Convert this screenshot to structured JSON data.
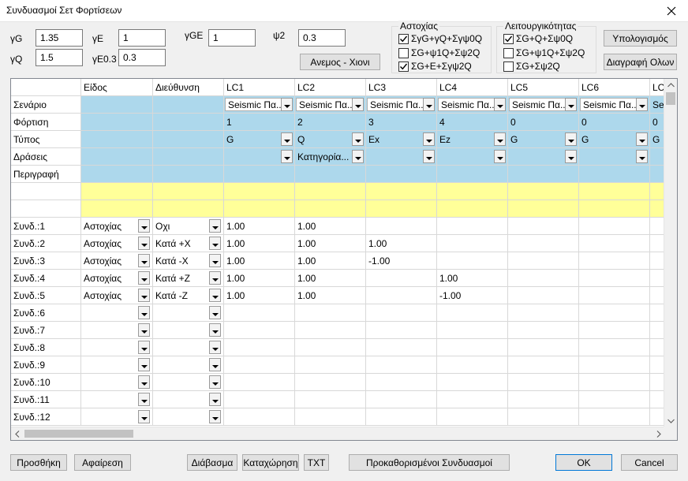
{
  "window": {
    "title": "Συνδυασμοί Σετ Φορτίσεων"
  },
  "params": {
    "gG_label": "γG",
    "gG": "1.35",
    "gQ_label": "γQ",
    "gQ": "1.5",
    "gE_label": "γE",
    "gE": "1",
    "gE03_label": "γE0.3",
    "gE03": "0.3",
    "gGE_label": "γGE",
    "gGE": "1",
    "psi2_label": "ψ2",
    "psi2": "0.3"
  },
  "buttons": {
    "wind_snow": "Ανεμος - Χιονι",
    "calculate": "Υπολογισμός",
    "delete_all": "Διαγραφή Ολων",
    "add": "Προσθήκη",
    "remove": "Αφαίρεση",
    "read": "Διάβασμα",
    "record": "Καταχώρηση",
    "txt": "TXT",
    "predefined": "Προκαθορισμένοι Συνδυασμοί",
    "ok": "OK",
    "cancel": "Cancel"
  },
  "ultimate": {
    "title": "Αστοχίας",
    "options": [
      {
        "label": "ΣγG+γQ+Σγψ0Q",
        "checked": true
      },
      {
        "label": "ΣG+ψ1Q+Σψ2Q",
        "checked": false
      },
      {
        "label": "ΣG+E+Σγψ2Q",
        "checked": true
      }
    ]
  },
  "service": {
    "title": "Λειτουργικότητας",
    "options": [
      {
        "label": "ΣG+Q+Σψ0Q",
        "checked": true
      },
      {
        "label": "ΣG+ψ1Q+Σψ2Q",
        "checked": false
      },
      {
        "label": "ΣG+Σψ2Q",
        "checked": false
      }
    ]
  },
  "grid": {
    "headers": [
      "",
      "Είδος",
      "Διεύθυνση",
      "LC1",
      "LC2",
      "LC3",
      "LC4",
      "LC5",
      "LC6",
      "LC"
    ],
    "prop_rows": [
      {
        "label": "Σενάριο",
        "values": [
          "Seismic Πα...",
          "Seismic Πα...",
          "Seismic Πα...",
          "Seismic Πα...",
          "Seismic Πα...",
          "Seismic Πα...",
          "Sei"
        ]
      },
      {
        "label": "Φόρτιση",
        "values": [
          "1",
          "2",
          "3",
          "4",
          "0",
          "0",
          "0"
        ]
      },
      {
        "label": "Τύπος",
        "values": [
          "G",
          "Q",
          "Ex",
          "Ez",
          "G",
          "G",
          "G"
        ]
      },
      {
        "label": "Δράσεις",
        "values": [
          "",
          "Κατηγορία...",
          "",
          "",
          "",
          "",
          ""
        ]
      },
      {
        "label": "Περιγραφή",
        "values": [
          "",
          "",
          "",
          "",
          "",
          "",
          ""
        ]
      }
    ],
    "combos": [
      {
        "label": "Συνδ.:1",
        "type": "Αστοχίας",
        "dir": "Οχι",
        "lc": [
          "1.00",
          "1.00",
          "",
          "",
          "",
          "",
          ""
        ]
      },
      {
        "label": "Συνδ.:2",
        "type": "Αστοχίας",
        "dir": "Κατά +X",
        "lc": [
          "1.00",
          "1.00",
          "1.00",
          "",
          "",
          "",
          ""
        ]
      },
      {
        "label": "Συνδ.:3",
        "type": "Αστοχίας",
        "dir": "Κατά -X",
        "lc": [
          "1.00",
          "1.00",
          "-1.00",
          "",
          "",
          "",
          ""
        ]
      },
      {
        "label": "Συνδ.:4",
        "type": "Αστοχίας",
        "dir": "Κατά +Z",
        "lc": [
          "1.00",
          "1.00",
          "",
          "1.00",
          "",
          "",
          ""
        ]
      },
      {
        "label": "Συνδ.:5",
        "type": "Αστοχίας",
        "dir": "Κατά -Z",
        "lc": [
          "1.00",
          "1.00",
          "",
          "-1.00",
          "",
          "",
          ""
        ]
      },
      {
        "label": "Συνδ.:6",
        "type": "",
        "dir": "",
        "lc": [
          "",
          "",
          "",
          "",
          "",
          "",
          ""
        ]
      },
      {
        "label": "Συνδ.:7",
        "type": "",
        "dir": "",
        "lc": [
          "",
          "",
          "",
          "",
          "",
          "",
          ""
        ]
      },
      {
        "label": "Συνδ.:8",
        "type": "",
        "dir": "",
        "lc": [
          "",
          "",
          "",
          "",
          "",
          "",
          ""
        ]
      },
      {
        "label": "Συνδ.:9",
        "type": "",
        "dir": "",
        "lc": [
          "",
          "",
          "",
          "",
          "",
          "",
          ""
        ]
      },
      {
        "label": "Συνδ.:10",
        "type": "",
        "dir": "",
        "lc": [
          "",
          "",
          "",
          "",
          "",
          "",
          ""
        ]
      },
      {
        "label": "Συνδ.:11",
        "type": "",
        "dir": "",
        "lc": [
          "",
          "",
          "",
          "",
          "",
          "",
          ""
        ]
      },
      {
        "label": "Συνδ.:12",
        "type": "",
        "dir": "",
        "lc": [
          "",
          "",
          "",
          "",
          "",
          "",
          ""
        ]
      }
    ]
  },
  "colors": {
    "blue": "#add8ec",
    "yellow": "#ffff99",
    "accent": "#0078d7"
  },
  "icons": {
    "close": "close-icon",
    "check": "check-icon",
    "dropdown": "chevron-down-icon"
  }
}
